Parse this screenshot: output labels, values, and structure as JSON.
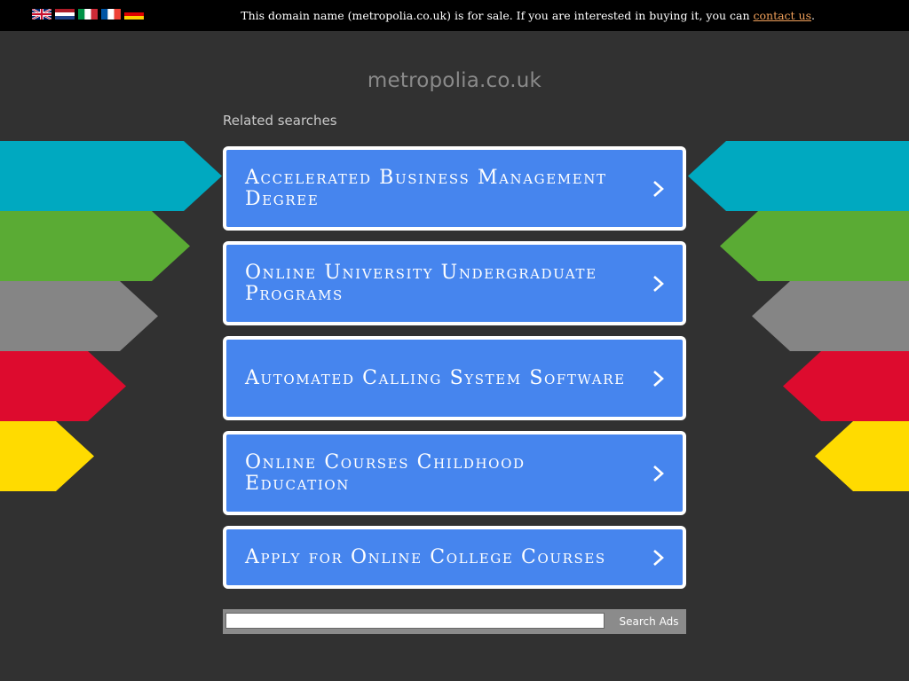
{
  "topbar": {
    "languages": [
      {
        "code": "en",
        "icon": "uk-flag-icon"
      },
      {
        "code": "nl",
        "icon": "netherlands-flag-icon"
      },
      {
        "code": "it",
        "icon": "italy-flag-icon"
      },
      {
        "code": "fr",
        "icon": "france-flag-icon"
      },
      {
        "code": "de",
        "icon": "germany-flag-icon"
      }
    ],
    "notice_text": "This domain name (metropolia.co.uk) is for sale. If you are interested in buying it, you can ",
    "contact_link": "contact us",
    "notice_end": "."
  },
  "domain_title": "metropolia.co.uk",
  "related_label": "Related searches",
  "links": [
    {
      "label": "Accelerated Business Management Degree"
    },
    {
      "label": "Online University Undergraduate Programs"
    },
    {
      "label": "Automated Calling System Software"
    },
    {
      "label": "Online Courses Childhood Education"
    },
    {
      "label": "Apply for Online College Courses"
    }
  ],
  "search": {
    "placeholder": "",
    "button_label": "Search Ads"
  },
  "colors": {
    "background": "#313131",
    "link_blue": "#4685ee",
    "arrow_cyan": "#00a9c0",
    "arrow_green": "#5aab34",
    "arrow_grey": "#858585",
    "arrow_red": "#dd0b2e",
    "arrow_yellow": "#ffdb00",
    "contact_link": "#f0a05a"
  }
}
